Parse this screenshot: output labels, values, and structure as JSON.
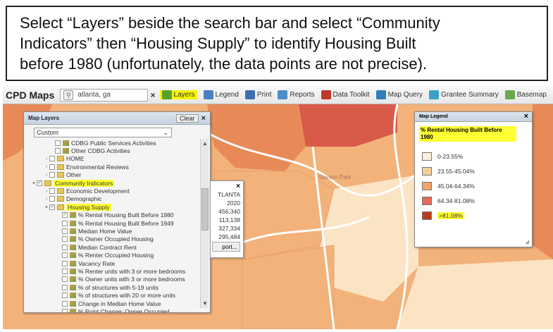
{
  "instruction": {
    "lines": [
      "Select “Layers” beside the search bar and select “Community",
      "Indicators” then “Housing Supply” to identify Housing Built",
      "before 1980 (unfortunately, the data points are not precise)."
    ]
  },
  "toolbar": {
    "app_title": "CPD Maps",
    "search_value": "atlanta, ga",
    "clear_symbol": "×",
    "buttons": [
      {
        "label": "Layers",
        "icon": "layers-icon",
        "color": "#5aa02c",
        "active": true
      },
      {
        "label": "Legend",
        "icon": "legend-icon",
        "color": "#4a7fbf",
        "active": false
      },
      {
        "label": "Print",
        "icon": "print-icon",
        "color": "#3d6fb0",
        "active": false
      },
      {
        "label": "Reports",
        "icon": "reports-icon",
        "color": "#4f8fc8",
        "active": false
      },
      {
        "label": "Data Toolkit",
        "icon": "data-toolkit-icon",
        "color": "#c0392b",
        "active": false
      },
      {
        "label": "Map Query",
        "icon": "map-query-icon",
        "color": "#2e7fb8",
        "active": false
      },
      {
        "label": "Grantee Summary",
        "icon": "grantee-summary-icon",
        "color": "#3aa0c8",
        "active": false
      },
      {
        "label": "Basemap",
        "icon": "basemap-icon",
        "color": "#6aa84f",
        "active": false
      }
    ]
  },
  "map": {
    "place_label": "Stanton Park"
  },
  "map_layers": {
    "title": "Map Layers",
    "clear_label": "Clear",
    "close_symbol": "×",
    "dropdown_value": "Custom",
    "items": [
      {
        "label": "CDBG Public Services Activities",
        "indent": 36,
        "type": "layer",
        "check": false,
        "toggle": "",
        "highlight": false
      },
      {
        "label": "Other CDBG Activities",
        "indent": 36,
        "type": "layer",
        "check": false,
        "toggle": "",
        "highlight": false
      },
      {
        "label": "HOME",
        "indent": 28,
        "type": "folder",
        "check": false,
        "toggle": "›",
        "highlight": false
      },
      {
        "label": "Environmental Reviews",
        "indent": 28,
        "type": "folder",
        "check": false,
        "toggle": "›",
        "highlight": false
      },
      {
        "label": "Other",
        "indent": 28,
        "type": "folder",
        "check": false,
        "toggle": "›",
        "highlight": false
      },
      {
        "label": "Community Indicators",
        "indent": 10,
        "type": "folder",
        "check": true,
        "toggle": "▾",
        "highlight": true
      },
      {
        "label": "Economic Development",
        "indent": 28,
        "type": "folder",
        "check": false,
        "toggle": "›",
        "highlight": false
      },
      {
        "label": "Demographic",
        "indent": 28,
        "type": "folder",
        "check": false,
        "toggle": "›",
        "highlight": false
      },
      {
        "label": "Housing Supply",
        "indent": 28,
        "type": "folder",
        "check": true,
        "toggle": "▾",
        "highlight": true
      },
      {
        "label": "% Rental Housing Built Before 1980",
        "indent": 46,
        "type": "layer",
        "check": true,
        "toggle": "",
        "highlight": false
      },
      {
        "label": "% Rental Housing Built Before 1949",
        "indent": 46,
        "type": "layer",
        "check": false,
        "toggle": "",
        "highlight": false
      },
      {
        "label": "Median Home Value",
        "indent": 46,
        "type": "layer",
        "check": false,
        "toggle": "",
        "highlight": false
      },
      {
        "label": "% Owner Occupied Housing",
        "indent": 46,
        "type": "layer",
        "check": false,
        "toggle": "",
        "highlight": false
      },
      {
        "label": "Median Contract Rent",
        "indent": 46,
        "type": "layer",
        "check": false,
        "toggle": "",
        "highlight": false
      },
      {
        "label": "% Renter Occupied Housing",
        "indent": 46,
        "type": "layer",
        "check": false,
        "toggle": "",
        "highlight": false
      },
      {
        "label": "Vacancy Rate",
        "indent": 46,
        "type": "layer",
        "check": false,
        "toggle": "",
        "highlight": false
      },
      {
        "label": "% Renter units with 3 or more bedrooms",
        "indent": 46,
        "type": "layer",
        "check": false,
        "toggle": "",
        "highlight": false
      },
      {
        "label": "% Owner units with 3 or more bedrooms",
        "indent": 46,
        "type": "layer",
        "check": false,
        "toggle": "",
        "highlight": false
      },
      {
        "label": "% of structures with 5-19 units",
        "indent": 46,
        "type": "layer",
        "check": false,
        "toggle": "",
        "highlight": false
      },
      {
        "label": "% of structures with 20 or more units",
        "indent": 46,
        "type": "layer",
        "check": false,
        "toggle": "",
        "highlight": false
      },
      {
        "label": "Change in Median Home Value",
        "indent": 46,
        "type": "layer",
        "check": false,
        "toggle": "",
        "highlight": false
      },
      {
        "label": "% Point Change: Owner Occupied",
        "indent": 46,
        "type": "layer",
        "check": false,
        "toggle": "",
        "highlight": false
      }
    ]
  },
  "popup": {
    "close_symbol": "×",
    "values": [
      "TLANTA",
      "2020",
      "456,340",
      "113,138",
      "327,334",
      "295,484"
    ],
    "button_label": "port..."
  },
  "map_legend": {
    "title": "Map Legend",
    "close_symbol": "×",
    "layer_title": "% Rental Housing Built Before 1980",
    "items": [
      {
        "label": "0-23.55%",
        "color": "#fdf1dc",
        "highlight": false
      },
      {
        "label": "23.55-45.04%",
        "color": "#f8cf99",
        "highlight": false
      },
      {
        "label": "45.04-64.34%",
        "color": "#f1a46d",
        "highlight": false
      },
      {
        "label": "64.34-81.08%",
        "color": "#e66a55",
        "highlight": false
      },
      {
        "label": ">81.08%",
        "color": "#b83a1d",
        "highlight": true
      }
    ]
  },
  "colors": {
    "highlight": "#ffff33",
    "map_light": "#fbe4c4",
    "map_mid": "#f2b27a",
    "map_dark": "#e88a58",
    "map_red": "#d85a48",
    "road": "#ffffff"
  }
}
